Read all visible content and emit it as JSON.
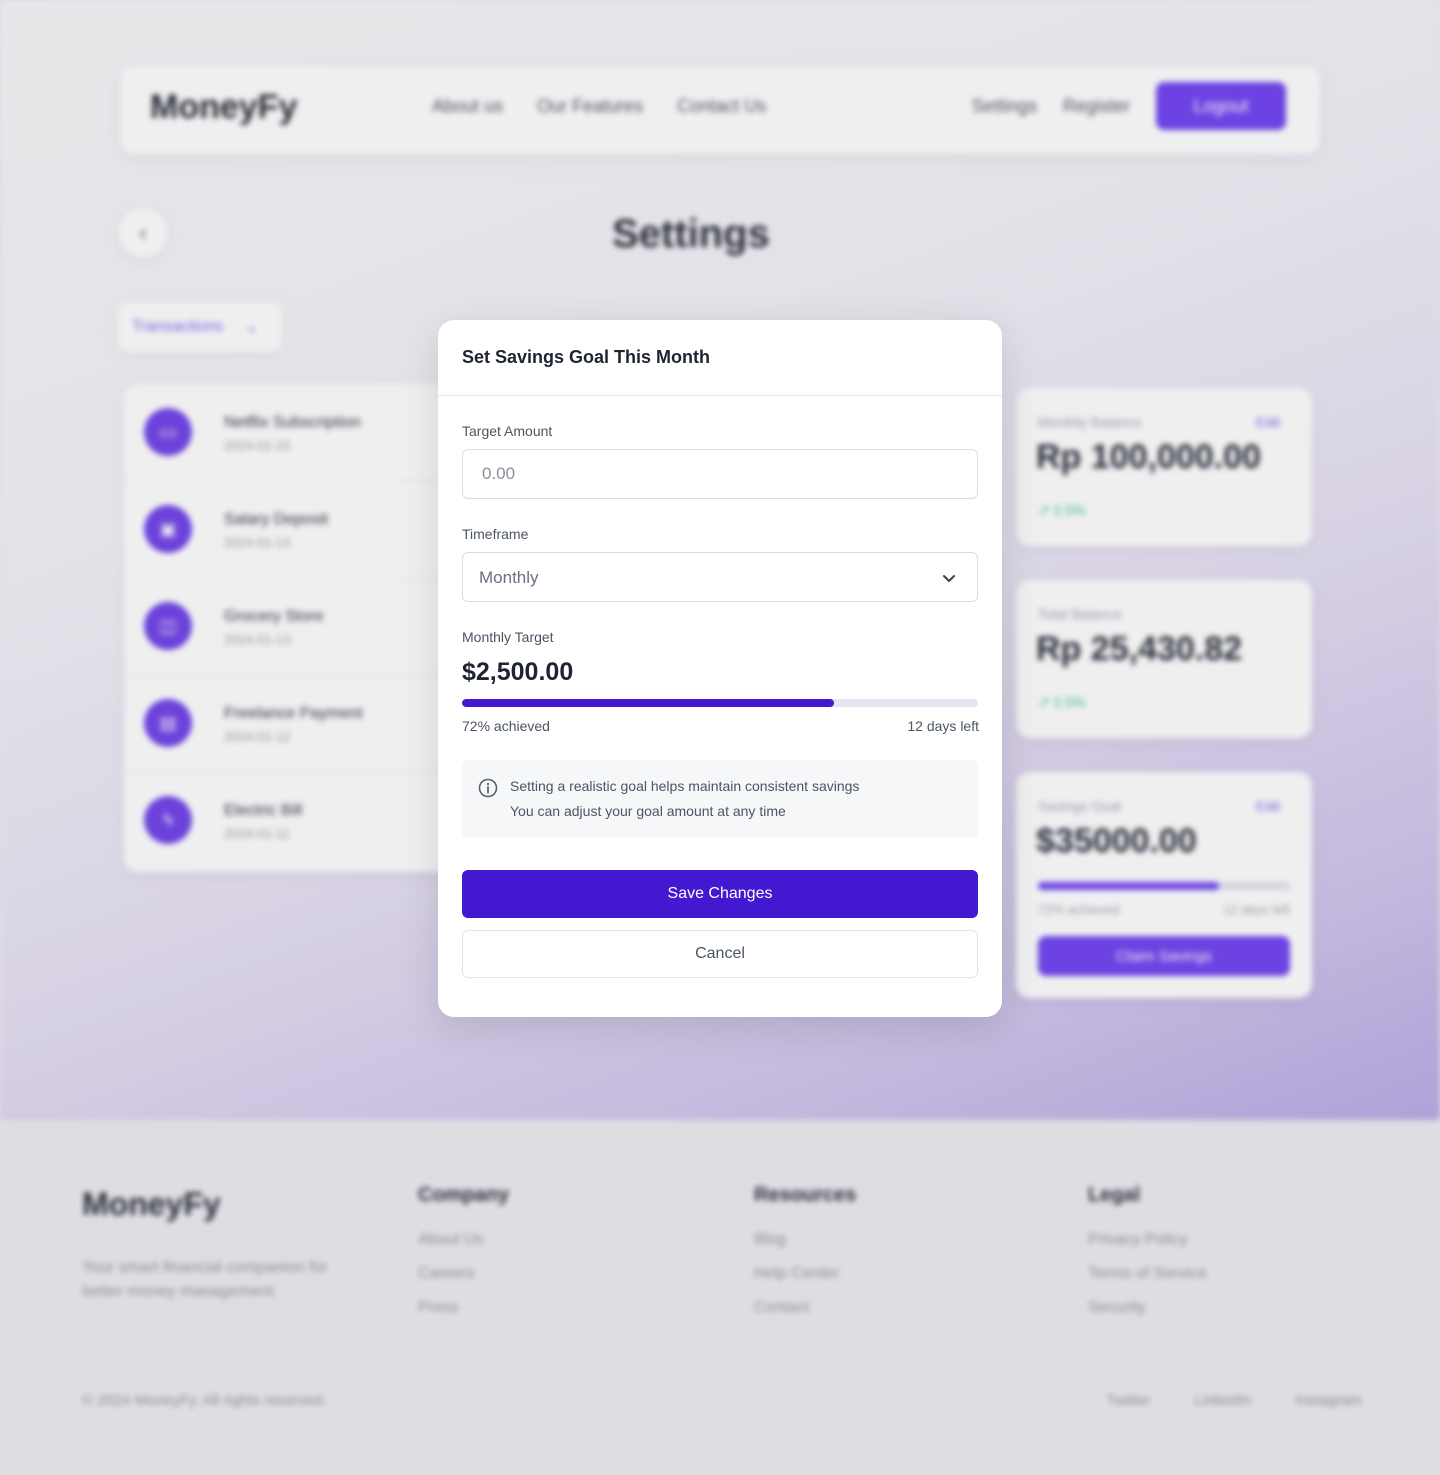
{
  "background": {
    "brand": "MoneyFy",
    "nav_links": [
      "About us",
      "Our Features",
      "Contact Us"
    ],
    "nav_right": [
      "Settings",
      "Register"
    ],
    "logout_label": "Logout",
    "page_title": "Settings",
    "back_icon": "chevron-left-icon",
    "transactions_dropdown": "Transactions",
    "transactions": [
      {
        "name": "Netflix Subscription",
        "date": "2024-01-15",
        "icon": "tv-icon"
      },
      {
        "name": "Salary Deposit",
        "date": "2024-01-14",
        "icon": "wallet-icon"
      },
      {
        "name": "Grocery Store",
        "date": "2024-01-13",
        "icon": "cart-icon"
      },
      {
        "name": "Freelance Payment",
        "date": "2024-01-12",
        "icon": "briefcase-icon"
      },
      {
        "name": "Electric Bill",
        "date": "2024-01-11",
        "icon": "bolt-icon"
      }
    ],
    "cards": {
      "monthly_balance": {
        "label": "Monthly Balance",
        "edit": "Edit",
        "value": "Rp 100,000.00",
        "trend": "2.5%"
      },
      "total_balance": {
        "label": "Total Balance",
        "value": "Rp 25,430.82",
        "trend": "2.5%"
      },
      "savings_goal": {
        "label": "Savings Goal",
        "edit": "Edit",
        "value": "$35000.00",
        "progress": 0.72,
        "achieved": "72% achieved",
        "days_left": "12 days left",
        "button": "Claim Savings"
      }
    },
    "footer": {
      "brand": "MoneyFy",
      "tagline": "Your smart financial companion for better money management.",
      "columns": [
        {
          "title": "Company",
          "links": [
            "About Us",
            "Careers",
            "Press"
          ]
        },
        {
          "title": "Resources",
          "links": [
            "Blog",
            "Help Center",
            "Contact"
          ]
        },
        {
          "title": "Legal",
          "links": [
            "Privacy Policy",
            "Terms of Service",
            "Security"
          ]
        }
      ],
      "copyright": "© 2024 MoneyFy. All rights reserved.",
      "social": [
        "Twitter",
        "LinkedIn",
        "Instagram"
      ]
    }
  },
  "modal": {
    "title": "Set Savings Goal This Month",
    "target_amount": {
      "label": "Target Amount",
      "placeholder": "0.00",
      "value": ""
    },
    "timeframe": {
      "label": "Timeframe",
      "selected": "Monthly",
      "icon": "chevron-down-icon"
    },
    "monthly_target": {
      "label": "Monthly Target",
      "amount": "$2,500.00",
      "progress": 0.72,
      "achieved_text": "72% achieved",
      "days_left_text": "12 days left"
    },
    "info": {
      "icon": "info-icon",
      "line1": "Setting a realistic goal helps maintain consistent savings",
      "line2": "You can adjust your goal amount at any time"
    },
    "save_label": "Save Changes",
    "cancel_label": "Cancel",
    "colors": {
      "primary": "#4318d1",
      "track": "#e3e6ee"
    }
  }
}
